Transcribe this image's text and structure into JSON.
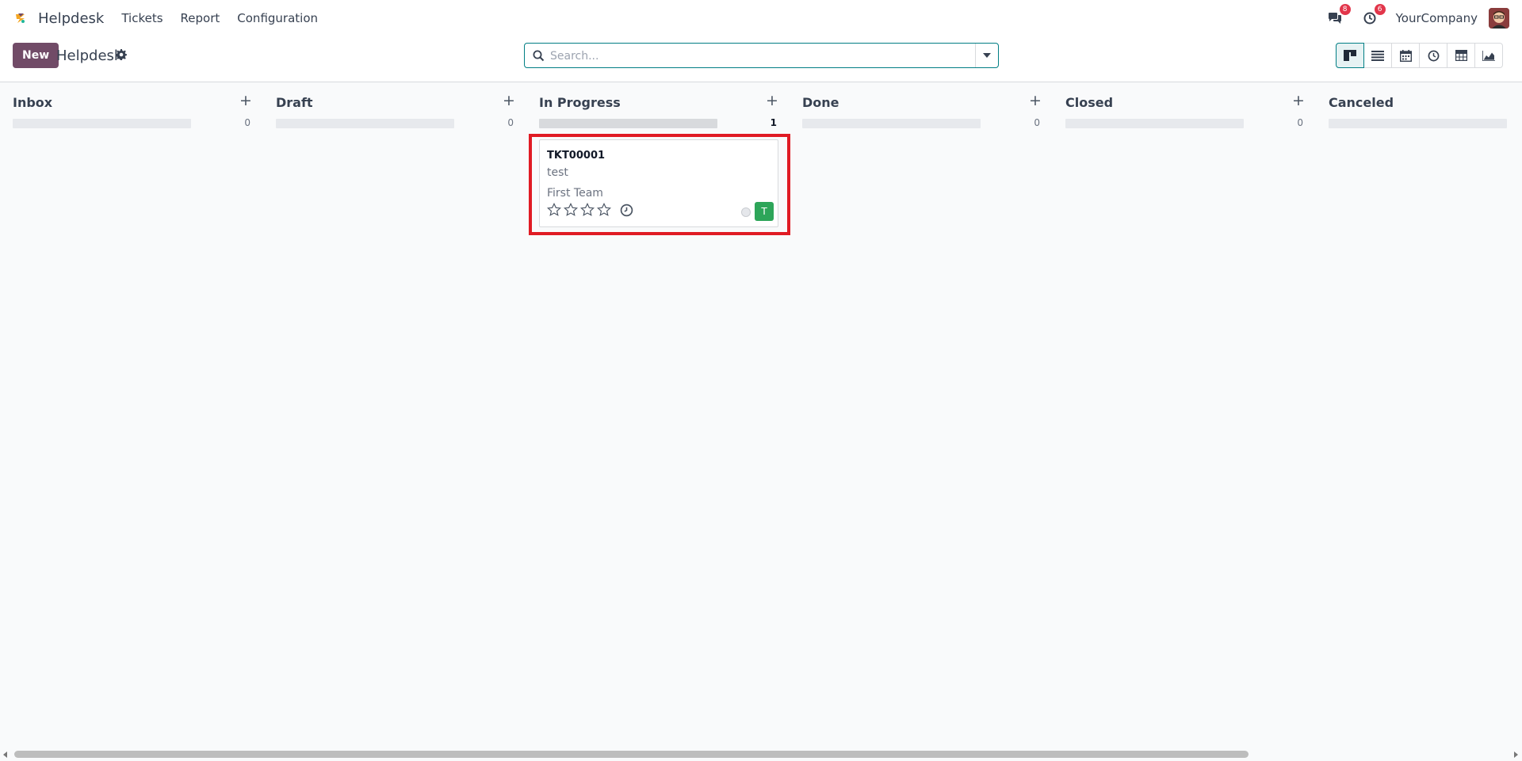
{
  "navbar": {
    "brand": "Helpdesk",
    "menus": [
      "Tickets",
      "Report",
      "Configuration"
    ],
    "messages_badge": "8",
    "activities_badge": "6",
    "company": "YourCompany"
  },
  "control": {
    "new_label": "New",
    "breadcrumb": "Helpdesk",
    "search_placeholder": "Search..."
  },
  "views": [
    "kanban-icon",
    "list-icon",
    "calendar-icon",
    "activity-icon",
    "pivot-icon",
    "graph-icon"
  ],
  "columns": [
    {
      "title": "Inbox",
      "count": "0"
    },
    {
      "title": "Draft",
      "count": "0"
    },
    {
      "title": "In Progress",
      "count": "1"
    },
    {
      "title": "Done",
      "count": "0"
    },
    {
      "title": "Closed",
      "count": "0"
    },
    {
      "title": "Canceled",
      "count": ""
    }
  ],
  "card": {
    "ref": "TKT00001",
    "name": "test",
    "team": "First Team",
    "rating": 0,
    "assignee_initial": "T"
  },
  "colors": {
    "primary": "#714b67",
    "accent": "#017e84",
    "badge": "#e2364b",
    "assignee": "#2da559",
    "highlight": "#e01b24"
  }
}
